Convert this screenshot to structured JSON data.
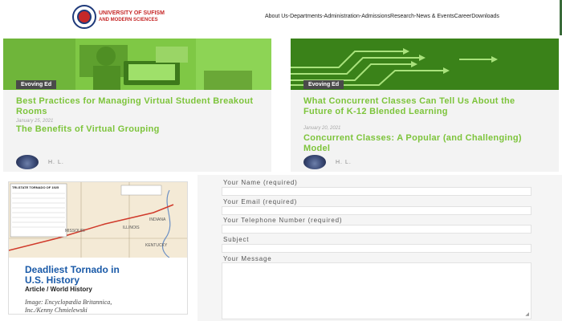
{
  "header": {
    "logo_line1": "UNIVERSITY OF SUFISM",
    "logo_line2": "AND MODERN SCIENCES",
    "nav": [
      "About Us",
      " -Departments",
      " -Administration",
      " -Admissions",
      "Research",
      " -News & Events",
      "Career",
      "Downloads"
    ]
  },
  "cards": [
    {
      "tag": "Evoving Ed",
      "title": "Best Practices for Managing Virtual Student Breakout Rooms",
      "date": "January 25, 2021",
      "subtitle": "The Benefits of Virtual Grouping",
      "author": "H. L."
    },
    {
      "tag": "Evoving Ed",
      "title": "What Concurrent Classes Can Tell Us About the Future of K-12 Blended Learning",
      "date": "January 20, 2021",
      "subtitle": "Concurrent Classes: A Popular (and Challenging) Model",
      "author": "H. L."
    }
  ],
  "article": {
    "map_title": "TRI-STATE TORNADO OF 1925",
    "map_labels": [
      "ILLINOIS",
      "MISSOURI",
      "INDIANA",
      "KENTUCKY"
    ],
    "title_line1": "Deadliest Tornado in",
    "title_line2": "U.S. History",
    "type": "Article / World History",
    "credit_line1": "Image: Encyclopædia Britannica,",
    "credit_line2": "Inc./Kenny Chmielewski"
  },
  "form": {
    "name_label": "Your Name (required)",
    "email_label": "Your Email (required)",
    "phone_label": "Your Telephone Number (required)",
    "subject_label": "Subject",
    "message_label": "Your Message"
  }
}
